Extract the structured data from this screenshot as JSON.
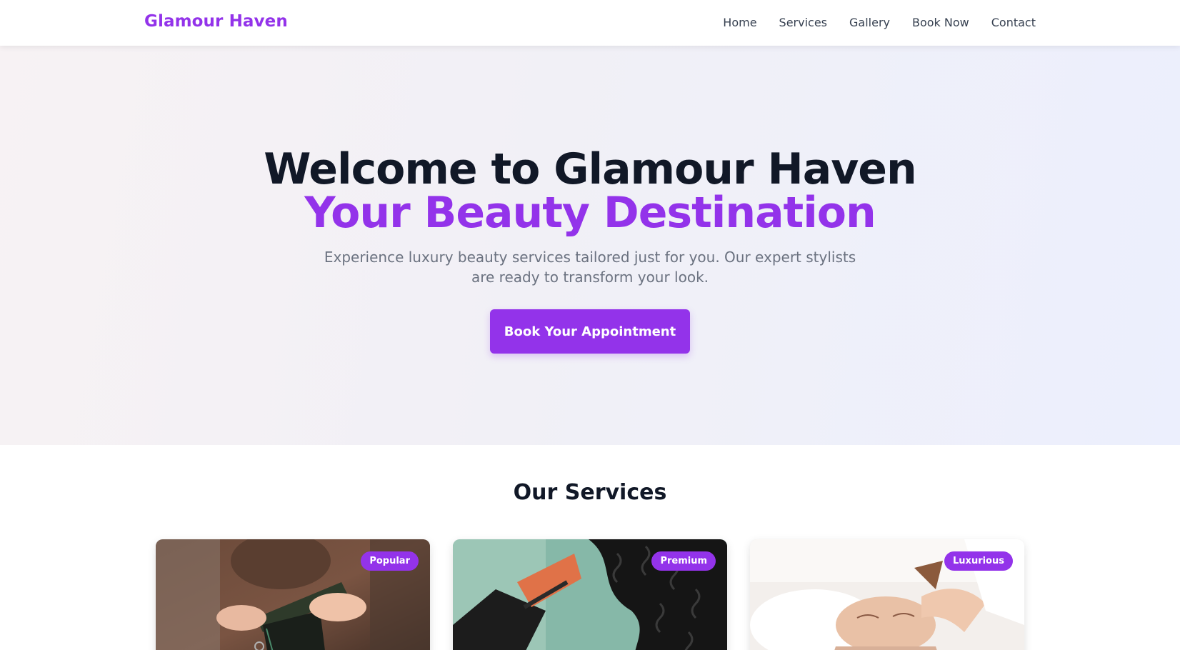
{
  "nav": {
    "brand": "Glamour Haven",
    "links": [
      "Home",
      "Services",
      "Gallery",
      "Book Now",
      "Contact"
    ]
  },
  "hero": {
    "title": "Welcome to Glamour Haven",
    "subtitle": "Your Beauty Destination",
    "description": "Experience luxury beauty services tailored just for you. Our expert stylists are ready to transform your look.",
    "cta_label": "Book Your Appointment"
  },
  "services": {
    "title": "Our Services",
    "cards": [
      {
        "badge": "Popular"
      },
      {
        "badge": "Premium"
      },
      {
        "badge": "Luxurious"
      }
    ]
  },
  "colors": {
    "accent": "#9333ea",
    "heading": "#111827",
    "muted": "#6b7280"
  }
}
